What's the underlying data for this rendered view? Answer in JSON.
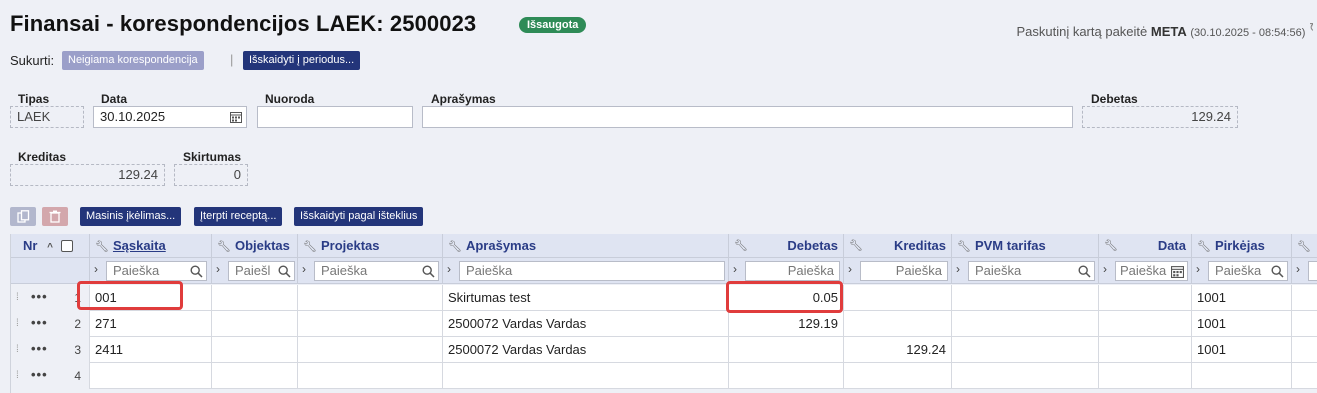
{
  "header": {
    "title": "Finansai - korespondencijos LAEK: 2500023",
    "status_badge": "Išsaugota",
    "modified_prefix": "Paskutinį kartą pakeitė",
    "modified_user": "META",
    "modified_date": "(30.10.2025 - 08:54:56)"
  },
  "create_bar": {
    "label": "Sukurti:",
    "negative_button": "Neigiama korespondencija",
    "separator": "|",
    "split_button": "Išskaidyti į periodus..."
  },
  "fields": {
    "tipas": {
      "label": "Tipas",
      "value": "LAEK"
    },
    "data": {
      "label": "Data",
      "value": "30.10.2025"
    },
    "nuoroda": {
      "label": "Nuoroda",
      "value": ""
    },
    "aprasymas": {
      "label": "Aprašymas",
      "value": ""
    },
    "debetas": {
      "label": "Debetas",
      "value": "129.24"
    },
    "kreditas": {
      "label": "Kreditas",
      "value": "129.24"
    },
    "skirtumas": {
      "label": "Skirtumas",
      "value": "0"
    }
  },
  "toolbar": {
    "bulk_import": "Masinis įkėlimas...",
    "insert_recipe": "Įterpti receptą...",
    "split_by_resources": "Išskaidyti pagal išteklius"
  },
  "grid": {
    "columns": {
      "nr": "Nr",
      "saskaita": "Sąskaita",
      "objektas": "Objektas",
      "projektas": "Projektas",
      "aprasymas": "Aprašymas",
      "debetas": "Debetas",
      "kreditas": "Kreditas",
      "pvm": "PVM tarifas",
      "data": "Data",
      "pirkejas": "Pirkėjas"
    },
    "filter_placeholder": "Paieška",
    "filter_placeholder_short": "Paiešl",
    "rows": [
      {
        "nr": "1",
        "saskaita": "001",
        "objektas": "",
        "projektas": "",
        "aprasymas": "Skirtumas test",
        "debetas": "0.05",
        "kreditas": "",
        "pvm": "",
        "data": "",
        "pirkejas": "1001"
      },
      {
        "nr": "2",
        "saskaita": "271",
        "objektas": "",
        "projektas": "",
        "aprasymas": "2500072 Vardas Vardas",
        "debetas": "129.19",
        "kreditas": "",
        "pvm": "",
        "data": "",
        "pirkejas": "1001"
      },
      {
        "nr": "3",
        "saskaita": "2411",
        "objektas": "",
        "projektas": "",
        "aprasymas": "2500072 Vardas Vardas",
        "debetas": "",
        "kreditas": "129.24",
        "pvm": "",
        "data": "",
        "pirkejas": "1001"
      },
      {
        "nr": "4",
        "saskaita": "",
        "objektas": "",
        "projektas": "",
        "aprasymas": "",
        "debetas": "",
        "kreditas": "",
        "pvm": "",
        "data": "",
        "pirkejas": ""
      }
    ]
  },
  "colors": {
    "accent": "#23357a",
    "badge": "#2e8b57",
    "highlight": "#e03c3c"
  }
}
